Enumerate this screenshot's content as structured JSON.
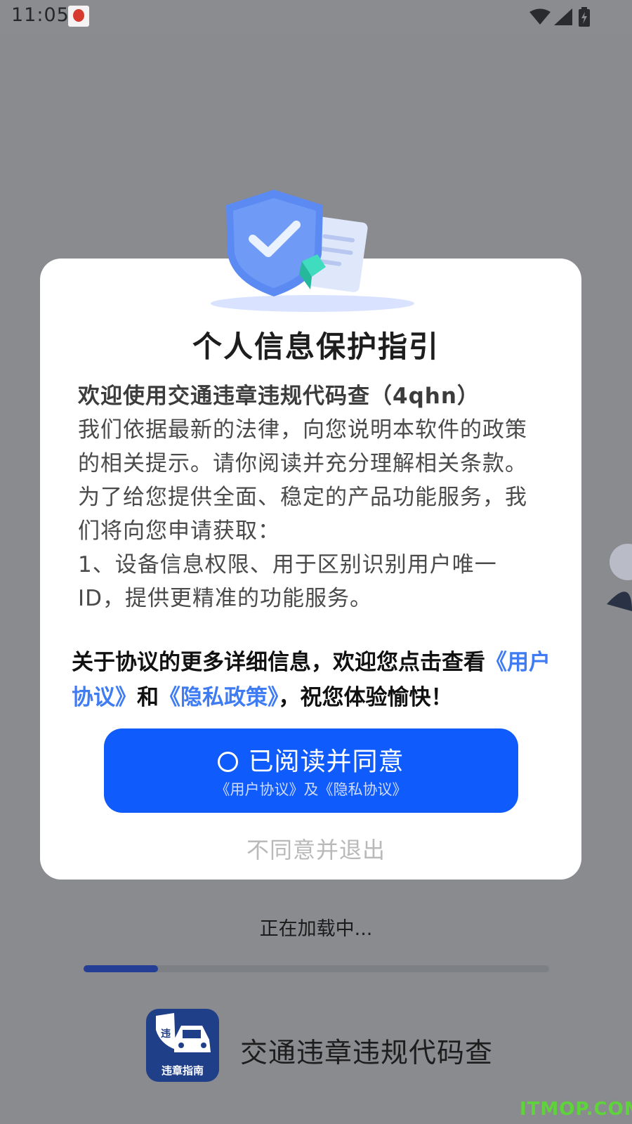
{
  "status_bar": {
    "time": "11:05"
  },
  "dialog": {
    "title": "个人信息保护指引",
    "lead": "欢迎使用交通违章违规代码查（4qhn）",
    "paragraph": "我们依据最新的法律，向您说明本软件的政策的相关提示。请你阅读并充分理解相关条款。为了给您提供全面、稳定的产品功能服务，我们将向您申请获取：",
    "item1": "1、设备信息权限、用于区别识别用户唯一ID，提供更精准的功能服务。",
    "note_before": "关于协议的更多详细信息，欢迎您点击查看",
    "user_agreement_link": "《用户协议》",
    "note_and": "和",
    "privacy_policy_link": "《隐私政策》",
    "note_after": "，祝您体验愉快！",
    "agree_label": "已阅读并同意",
    "agree_sub": "《用户协议》及《隐私协议》",
    "disagree_label": "不同意并退出"
  },
  "loading": {
    "text": "正在加载中...",
    "progress": 0.16
  },
  "app": {
    "logo_label": "违章指南",
    "name": "交通违章违规代码查"
  },
  "watermark": "ITMOP.COM",
  "colors": {
    "primary": "#0f5bfc",
    "link": "#3f7cf3",
    "progress": "#243e95"
  }
}
